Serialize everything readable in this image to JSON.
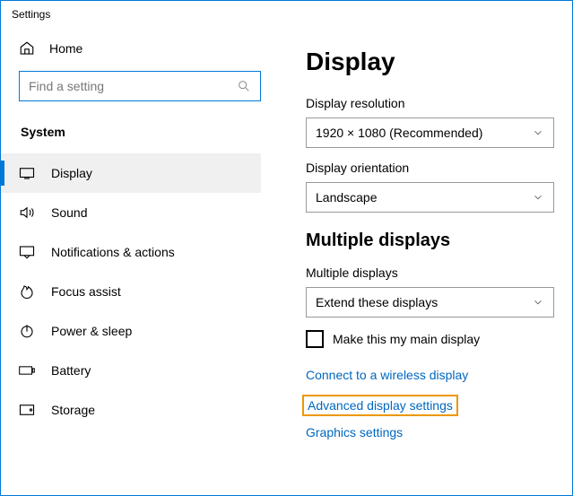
{
  "window": {
    "title": "Settings"
  },
  "sidebar": {
    "home": "Home",
    "search_placeholder": "Find a setting",
    "category": "System",
    "items": [
      {
        "label": "Display"
      },
      {
        "label": "Sound"
      },
      {
        "label": "Notifications & actions"
      },
      {
        "label": "Focus assist"
      },
      {
        "label": "Power & sleep"
      },
      {
        "label": "Battery"
      },
      {
        "label": "Storage"
      }
    ]
  },
  "main": {
    "title": "Display",
    "resolution_label": "Display resolution",
    "resolution_value": "1920 × 1080 (Recommended)",
    "orientation_label": "Display orientation",
    "orientation_value": "Landscape",
    "multiple_heading": "Multiple displays",
    "multiple_label": "Multiple displays",
    "multiple_value": "Extend these displays",
    "checkbox": "Make this my main display",
    "link1": "Connect to a wireless display",
    "link2": "Advanced display settings",
    "link3": "Graphics settings"
  }
}
